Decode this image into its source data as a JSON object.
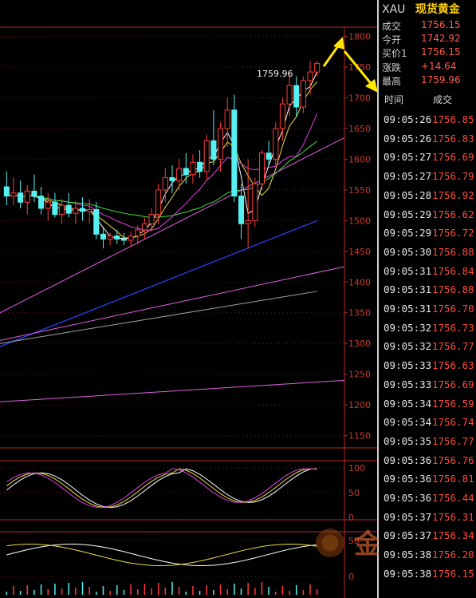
{
  "header": {
    "symbol": "XAU",
    "name": "现货黄金"
  },
  "quote": [
    {
      "label": "成交",
      "value": "1756.15"
    },
    {
      "label": "今开",
      "value": "1742.92"
    },
    {
      "label": "买价1",
      "value": "1756.15"
    },
    {
      "label": "涨跌",
      "value": "+14.64"
    },
    {
      "label": "最高",
      "value": "1759.96"
    }
  ],
  "trades_header": {
    "time": "时间",
    "price": "成交"
  },
  "trades": [
    {
      "time": "09:05:26",
      "price": "1756.85"
    },
    {
      "time": "09:05:26",
      "price": "1756.83"
    },
    {
      "time": "09:05:27",
      "price": "1756.69"
    },
    {
      "time": "09:05:27",
      "price": "1756.79"
    },
    {
      "time": "09:05:28",
      "price": "1756.92"
    },
    {
      "time": "09:05:29",
      "price": "1756.62"
    },
    {
      "time": "09:05:29",
      "price": "1756.72"
    },
    {
      "time": "09:05:30",
      "price": "1756.88"
    },
    {
      "time": "09:05:31",
      "price": "1756.84"
    },
    {
      "time": "09:05:31",
      "price": "1756.88"
    },
    {
      "time": "09:05:31",
      "price": "1756.70"
    },
    {
      "time": "09:05:32",
      "price": "1756.73"
    },
    {
      "time": "09:05:32",
      "price": "1756.77"
    },
    {
      "time": "09:05:33",
      "price": "1756.63"
    },
    {
      "time": "09:05:33",
      "price": "1756.69"
    },
    {
      "time": "09:05:34",
      "price": "1756.59"
    },
    {
      "time": "09:05:34",
      "price": "1756.74"
    },
    {
      "time": "09:05:35",
      "price": "1756.77"
    },
    {
      "time": "09:05:36",
      "price": "1756.76"
    },
    {
      "time": "09:05:36",
      "price": "1756.81"
    },
    {
      "time": "09:05:36",
      "price": "1756.44"
    },
    {
      "time": "09:05:37",
      "price": "1756.31"
    },
    {
      "time": "09:05:37",
      "price": "1756.34"
    },
    {
      "time": "09:05:38",
      "price": "1756.20"
    },
    {
      "time": "09:05:38",
      "price": "1756.15"
    }
  ],
  "chart_data": {
    "type": "candlestick",
    "high_label": "1759.96",
    "price_axis": {
      "ticks": [
        1800,
        1750,
        1700,
        1650,
        1600,
        1550,
        1500,
        1450,
        1400,
        1350,
        1300,
        1250,
        1200,
        1150
      ],
      "range": [
        1130,
        1815
      ]
    },
    "indicator1_axis": {
      "ticks": [
        100,
        50,
        0
      ],
      "range": [
        0,
        100
      ]
    },
    "indicator2_axis": {
      "ticks": [
        50,
        0
      ],
      "range": [
        0,
        60
      ]
    },
    "colors": {
      "up": "#ff3b3b",
      "down": "#56f0f0",
      "frame": "#b8282a",
      "axis_text": "#c83a2f",
      "arrow": "#ffe600"
    },
    "candles": [
      {
        "o": 1555,
        "h": 1580,
        "l": 1525,
        "c": 1540
      },
      {
        "o": 1540,
        "h": 1570,
        "l": 1525,
        "c": 1545
      },
      {
        "o": 1545,
        "h": 1565,
        "l": 1520,
        "c": 1530
      },
      {
        "o": 1530,
        "h": 1558,
        "l": 1510,
        "c": 1548
      },
      {
        "o": 1548,
        "h": 1575,
        "l": 1530,
        "c": 1540
      },
      {
        "o": 1540,
        "h": 1555,
        "l": 1510,
        "c": 1520
      },
      {
        "o": 1520,
        "h": 1545,
        "l": 1500,
        "c": 1530
      },
      {
        "o": 1530,
        "h": 1545,
        "l": 1505,
        "c": 1510
      },
      {
        "o": 1510,
        "h": 1535,
        "l": 1495,
        "c": 1525
      },
      {
        "o": 1525,
        "h": 1545,
        "l": 1505,
        "c": 1512
      },
      {
        "o": 1512,
        "h": 1532,
        "l": 1495,
        "c": 1520
      },
      {
        "o": 1520,
        "h": 1538,
        "l": 1500,
        "c": 1515
      },
      {
        "o": 1515,
        "h": 1535,
        "l": 1495,
        "c": 1518
      },
      {
        "o": 1518,
        "h": 1530,
        "l": 1470,
        "c": 1478
      },
      {
        "o": 1478,
        "h": 1490,
        "l": 1455,
        "c": 1470
      },
      {
        "o": 1470,
        "h": 1480,
        "l": 1460,
        "c": 1475
      },
      {
        "o": 1475,
        "h": 1485,
        "l": 1462,
        "c": 1470
      },
      {
        "o": 1470,
        "h": 1480,
        "l": 1460,
        "c": 1468
      },
      {
        "o": 1468,
        "h": 1482,
        "l": 1458,
        "c": 1475
      },
      {
        "o": 1475,
        "h": 1492,
        "l": 1462,
        "c": 1485
      },
      {
        "o": 1485,
        "h": 1505,
        "l": 1470,
        "c": 1495
      },
      {
        "o": 1495,
        "h": 1520,
        "l": 1482,
        "c": 1510
      },
      {
        "o": 1510,
        "h": 1560,
        "l": 1495,
        "c": 1550
      },
      {
        "o": 1550,
        "h": 1585,
        "l": 1530,
        "c": 1570
      },
      {
        "o": 1570,
        "h": 1590,
        "l": 1545,
        "c": 1565
      },
      {
        "o": 1565,
        "h": 1600,
        "l": 1550,
        "c": 1585
      },
      {
        "o": 1585,
        "h": 1610,
        "l": 1560,
        "c": 1575
      },
      {
        "o": 1575,
        "h": 1608,
        "l": 1560,
        "c": 1595
      },
      {
        "o": 1595,
        "h": 1615,
        "l": 1570,
        "c": 1580
      },
      {
        "o": 1580,
        "h": 1640,
        "l": 1565,
        "c": 1630
      },
      {
        "o": 1630,
        "h": 1680,
        "l": 1590,
        "c": 1600
      },
      {
        "o": 1600,
        "h": 1660,
        "l": 1580,
        "c": 1650
      },
      {
        "o": 1650,
        "h": 1700,
        "l": 1620,
        "c": 1680
      },
      {
        "o": 1680,
        "h": 1705,
        "l": 1530,
        "c": 1540
      },
      {
        "o": 1540,
        "h": 1560,
        "l": 1470,
        "c": 1495
      },
      {
        "o": 1495,
        "h": 1600,
        "l": 1455,
        "c": 1500
      },
      {
        "o": 1500,
        "h": 1570,
        "l": 1490,
        "c": 1560
      },
      {
        "o": 1560,
        "h": 1615,
        "l": 1550,
        "c": 1610
      },
      {
        "o": 1610,
        "h": 1630,
        "l": 1590,
        "c": 1600
      },
      {
        "o": 1600,
        "h": 1660,
        "l": 1590,
        "c": 1650
      },
      {
        "o": 1650,
        "h": 1700,
        "l": 1630,
        "c": 1690
      },
      {
        "o": 1690,
        "h": 1740,
        "l": 1670,
        "c": 1720
      },
      {
        "o": 1720,
        "h": 1735,
        "l": 1670,
        "c": 1685
      },
      {
        "o": 1685,
        "h": 1735,
        "l": 1675,
        "c": 1728
      },
      {
        "o": 1728,
        "h": 1760,
        "l": 1705,
        "c": 1742
      },
      {
        "o": 1742,
        "h": 1760,
        "l": 1735,
        "c": 1756
      }
    ]
  }
}
